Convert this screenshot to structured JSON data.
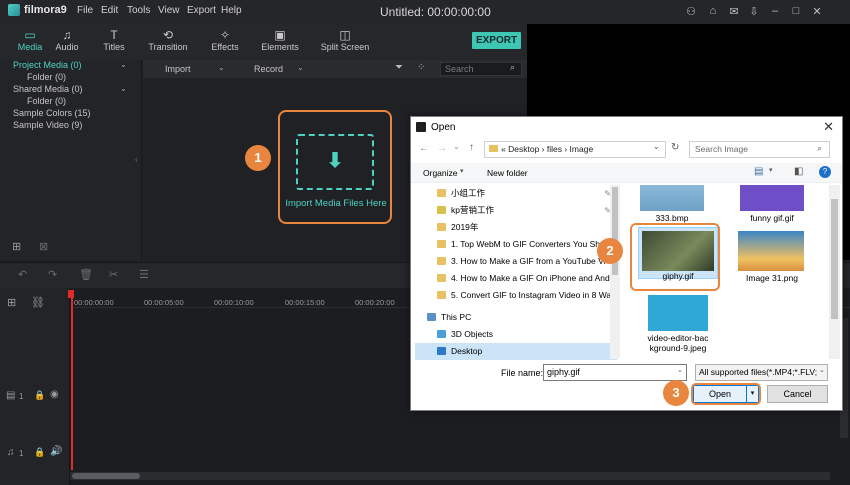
{
  "app": {
    "logo": "filmora9",
    "menu": [
      "File",
      "Edit",
      "Tools",
      "View",
      "Export",
      "Help"
    ],
    "title": "Untitled:",
    "timecode": "00:00:00:00",
    "window_icons": [
      "user-icon",
      "gift-icon",
      "mail-icon",
      "save-icon",
      "minimize-icon",
      "maximize-icon",
      "close-icon"
    ]
  },
  "toolbar": {
    "tabs": [
      {
        "label": "Media",
        "icon": "folder-icon"
      },
      {
        "label": "Audio",
        "icon": "music-icon"
      },
      {
        "label": "Titles",
        "icon": "text-icon"
      },
      {
        "label": "Transition",
        "icon": "transition-icon"
      },
      {
        "label": "Effects",
        "icon": "effects-icon"
      },
      {
        "label": "Elements",
        "icon": "image-icon"
      },
      {
        "label": "Split Screen",
        "icon": "split-screen-icon"
      }
    ],
    "export_label": "EXPORT"
  },
  "library": {
    "items": [
      {
        "label": "Project Media (0)",
        "indent": 0,
        "active": true,
        "chevron": true
      },
      {
        "label": "Folder (0)",
        "indent": 1
      },
      {
        "label": "Shared Media (0)",
        "indent": 0,
        "chevron": true
      },
      {
        "label": "Folder (0)",
        "indent": 1
      },
      {
        "label": "Sample Colors (15)",
        "indent": 0
      },
      {
        "label": "Sample Video (9)",
        "indent": 0
      }
    ]
  },
  "media": {
    "import_label": "Import",
    "record_label": "Record",
    "search_placeholder": "Search",
    "import_files_label": "Import Media Files Here"
  },
  "steps": [
    "1",
    "2",
    "3"
  ],
  "timeline": {
    "ruler": [
      "00:00:00:00",
      "00:00:05:00",
      "00:00:10:00",
      "00:00:15:00",
      "00:00:20:00"
    ],
    "video_track": "1",
    "audio_track": "1"
  },
  "dialog": {
    "title": "Open",
    "path": [
      "Desktop",
      "files",
      "Image"
    ],
    "path_prefix": "«",
    "search_placeholder": "Search Image",
    "organize_label": "Organize",
    "new_folder_label": "New folder",
    "nav_items": [
      {
        "label": "小组工作",
        "pinned": true
      },
      {
        "label": "kp营销工作",
        "pinned": true
      },
      {
        "label": "2019年"
      },
      {
        "label": "1. Top WebM to GIF Converters You Shou"
      },
      {
        "label": "3. How to Make a GIF from a YouTube Vi"
      },
      {
        "label": "4. How to Make a GIF On iPhone and Androi"
      },
      {
        "label": "5. Convert GIF to Instagram Video in 8 Ways"
      },
      {
        "label": "This PC",
        "type": "pc"
      },
      {
        "label": "3D Objects",
        "type": "obj"
      },
      {
        "label": "Desktop",
        "type": "desktop",
        "selected": true
      }
    ],
    "files": [
      {
        "name": "333.bmp"
      },
      {
        "name": "funny gif.gif"
      },
      {
        "name": "giphy.gif",
        "selected": true
      },
      {
        "name": "Image 31.png"
      },
      {
        "name": "video-editor-background-9.jpeg",
        "line1": "video-editor-bac",
        "line2": "kground-9.jpeg"
      }
    ],
    "file_name_label": "File name:",
    "file_name_value": "giphy.gif",
    "file_type": "All supported files(*.MP4;*.FLV;",
    "open_label": "Open",
    "cancel_label": "Cancel"
  }
}
